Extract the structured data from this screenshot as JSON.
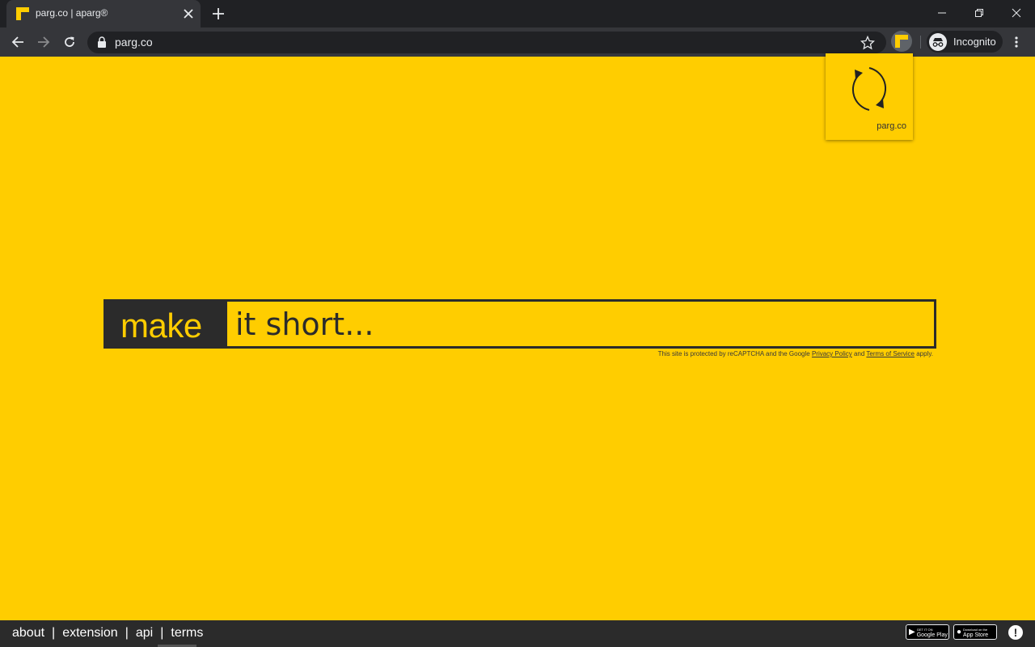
{
  "browser": {
    "tab_title": "parg.co | aparg®",
    "url": "parg.co",
    "profile_label": "Incognito"
  },
  "extension_popup": {
    "label": "parg.co"
  },
  "main": {
    "make_label": "make",
    "input_placeholder": "it short...",
    "recaptcha_prefix": "This site is protected by reCAPTCHA and the Google",
    "privacy_link": "Privacy Policy",
    "and_text": "and",
    "terms_of_service_link": "Terms of Service",
    "apply_text": "apply."
  },
  "footer": {
    "links": [
      "about",
      "extension",
      "api",
      "terms"
    ],
    "separator": "|",
    "google_play": {
      "small": "GET IT ON",
      "big": "Google Play"
    },
    "app_store": {
      "small": "Download on the",
      "big": "App Store"
    }
  },
  "colors": {
    "brand_yellow": "#ffcd00",
    "dark": "#2b2b2b"
  }
}
